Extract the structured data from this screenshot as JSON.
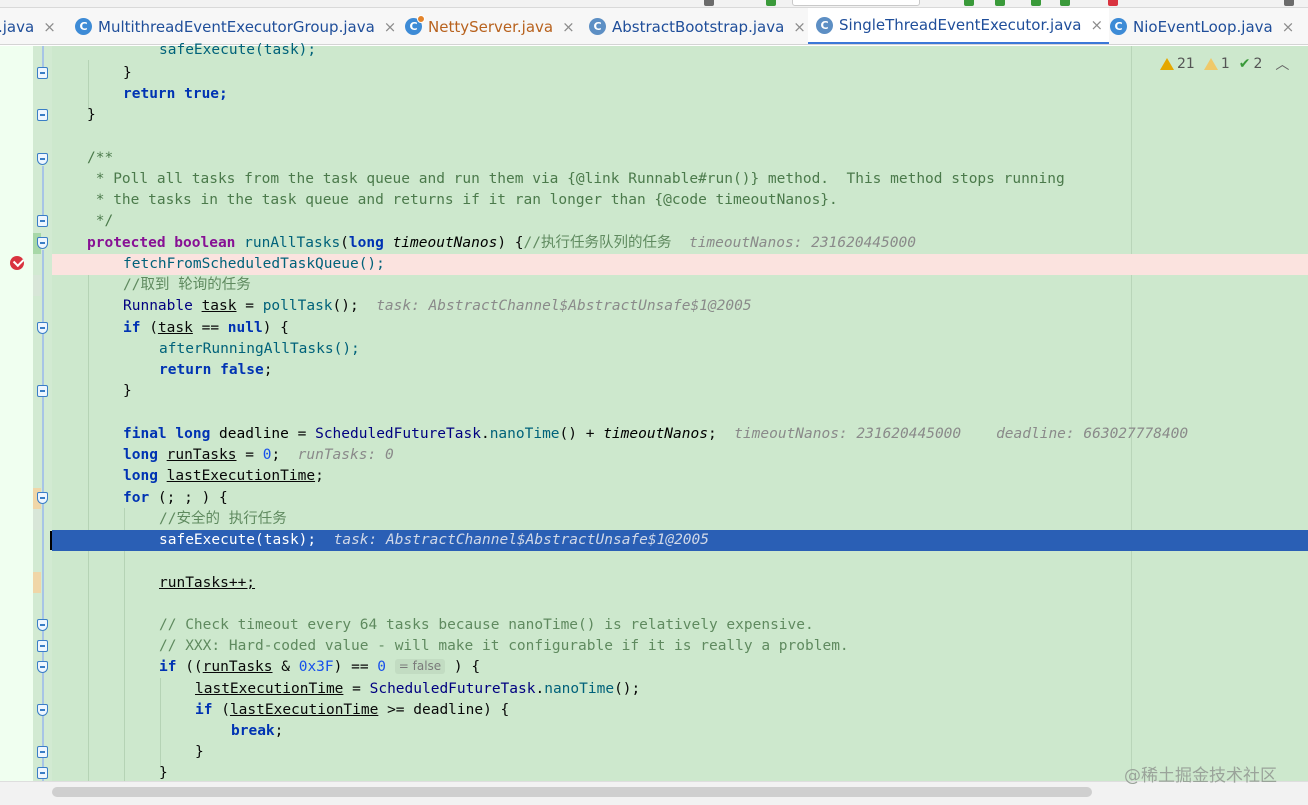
{
  "tabs": [
    {
      "label": ".java",
      "icon": "class-icon"
    },
    {
      "label": "MultithreadEventExecutorGroup.java",
      "icon": "class-icon"
    },
    {
      "label": "NettyServer.java",
      "icon": "runnable-class-icon"
    },
    {
      "label": "AbstractBootstrap.java",
      "icon": "abstract-class-icon"
    },
    {
      "label": "SingleThreadEventExecutor.java",
      "icon": "abstract-class-icon",
      "active": true
    },
    {
      "label": "NioEventLoop.java",
      "icon": "class-icon"
    }
  ],
  "tab_close_glyph": "×",
  "inspections": {
    "warnings": "21",
    "weak_warnings": "1",
    "typos": "2"
  },
  "code": {
    "l1": "safeExecute(task);",
    "l2": "}",
    "l3": "return true;",
    "l4": "}",
    "doc_open": "/**",
    "doc1": " * Poll all tasks from the task queue and run them via {@link Runnable#run()} method.  This method stops running",
    "doc2": " * the tasks in the task queue and returns if it ran longer than {@code timeoutNanos}.",
    "doc_close": " */",
    "sig_comment": "//执行任务队列的任务",
    "sig_hint": "timeoutNanos: 231620445000",
    "fetch": "fetchFromScheduledTaskQueue();",
    "poll_comment": "//取到 轮询的任务",
    "poll_hint": "task: AbstractChannel$AbstractUnsafe$1@2005",
    "afterRunning": "afterRunningAllTasks();",
    "deadline_hint1": "timeoutNanos: 231620445000",
    "deadline_hint2": "deadline: 663027778400",
    "runtasks_hint": "runTasks: 0",
    "safe_comment": "//安全的 执行任务",
    "safe_hint": "task: AbstractChannel$AbstractUnsafe$1@2005",
    "runTasksInc": "runTasks++;",
    "check_comment": "// Check timeout every 64 tasks because nanoTime() is relatively expensive.",
    "xxx_comment": "// XXX: Hard-coded value - will make it configurable if it is really a problem.",
    "false_inlay": "= false"
  },
  "watermark": "@稀土掘金技术社区"
}
